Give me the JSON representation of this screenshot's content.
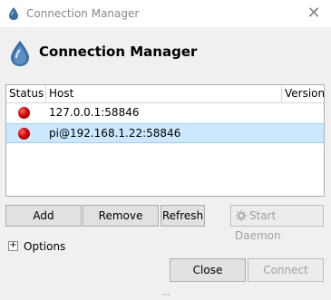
{
  "window": {
    "title": "Connection Manager",
    "close_glyph": "✕"
  },
  "header": {
    "title": "Connection Manager"
  },
  "table": {
    "columns": [
      "Status",
      "Host",
      "Version"
    ],
    "rows": [
      {
        "status": "offline",
        "host": "127.0.0.1:58846",
        "version": ""
      },
      {
        "status": "offline",
        "host": "pi@192.168.1.22:58846",
        "version": ""
      }
    ],
    "selected_row": 1
  },
  "buttons": {
    "add": "Add",
    "remove": "Remove",
    "refresh": "Refresh",
    "start_daemon": "Start Daemon"
  },
  "options": {
    "expander": "+",
    "label": "Options"
  },
  "footer": {
    "close": "Close",
    "connect": "Connect"
  },
  "colors": {
    "status_offline": "#d40000",
    "selection": "#cce8ff",
    "app_icon": "#3a6ea5"
  }
}
